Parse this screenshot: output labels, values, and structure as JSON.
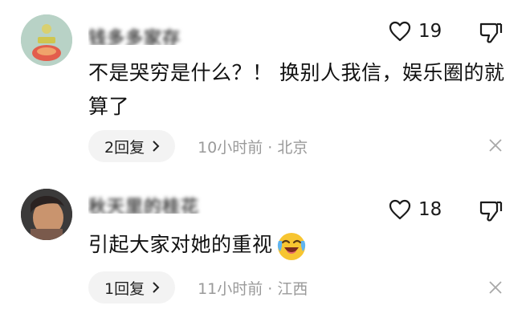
{
  "comments": [
    {
      "username": "钱多多家存",
      "like_count": "19",
      "text": "不是哭穷是什么？！ 换别人我信，娱乐圈的就算了",
      "reply_label": "2回复",
      "meta": "10小时前 · 北京"
    },
    {
      "username": "秋天里的桂花",
      "like_count": "18",
      "text": "引起大家对她的重视",
      "reply_label": "1回复",
      "meta": "11小时前 · 江西"
    }
  ],
  "icons": {
    "like": "heart-outline-icon",
    "dislike": "thumbs-down-icon",
    "close": "close-icon",
    "reply_chevron": "chevron-right-icon",
    "emoji": "laughing-crying-emoji-icon"
  }
}
